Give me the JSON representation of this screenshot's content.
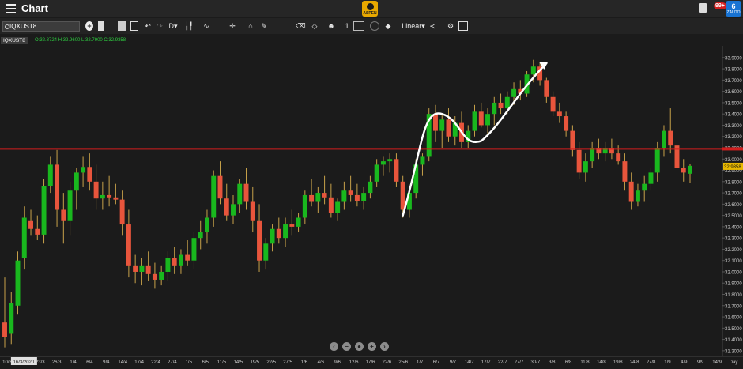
{
  "app": {
    "title": "Chart",
    "logo_text": "ASPEN",
    "notification_count": "99+",
    "zaloo_label": "ZALOO",
    "zaloo_number": "6"
  },
  "toolbar": {
    "symbol": "IQXUST8",
    "interval": "D",
    "line_width": "1",
    "scale": "Linear",
    "icons": [
      "plus-circle-icon",
      "new-page-icon",
      "open-folder-icon",
      "image-icon",
      "share-icon",
      "undo-icon",
      "redo-icon",
      "interval-dropdown",
      "candle-type-icon",
      "indicator-icon",
      "crosshair-icon",
      "alert-icon",
      "pen-icon",
      "eraser-icon",
      "fill-icon",
      "emoji-icon",
      "line-width-icon",
      "color-icon",
      "cancel-icon",
      "tag-icon",
      "scale-dropdown",
      "share-nodes-icon",
      "settings-icon",
      "keyboard-icon"
    ]
  },
  "chart_info": {
    "symbol_label": "IQXUST8",
    "ohlc_text": "O:32.8724  H:32.9600  L:32.7900  C:32.9358"
  },
  "colors": {
    "up": "#19b81e",
    "down": "#e8553c",
    "wick": "#c8a24a",
    "hline": "#d21e1e",
    "annotation": "#ffffff",
    "background": "#1b1b1b",
    "last_price_bg": "#e8b800"
  },
  "chart_data": {
    "type": "candlestick",
    "ylim": [
      31.25,
      33.99
    ],
    "y_ticks": [
      "33.9000",
      "33.8000",
      "33.7000",
      "33.6000",
      "33.5000",
      "33.4000",
      "33.3000",
      "33.2000",
      "33.1000",
      "33.0000",
      "32.9000",
      "32.8000",
      "32.7000",
      "32.6000",
      "32.5000",
      "32.4000",
      "32.3000",
      "32.2000",
      "32.1000",
      "32.0000",
      "31.9000",
      "31.8000",
      "31.7000",
      "31.6000",
      "31.5000",
      "31.4000",
      "31.3000"
    ],
    "x_tick_labels": [
      "10/3",
      "16/3/2020",
      "23/3",
      "26/3",
      "1/4",
      "6/4",
      "9/4",
      "14/4",
      "17/4",
      "22/4",
      "27/4",
      "1/5",
      "6/5",
      "11/5",
      "14/5",
      "19/5",
      "22/5",
      "27/5",
      "1/6",
      "4/6",
      "9/6",
      "12/6",
      "17/6",
      "22/6",
      "25/6",
      "1/7",
      "6/7",
      "9/7",
      "14/7",
      "17/7",
      "22/7",
      "27/7",
      "30/7",
      "3/8",
      "6/8",
      "11/8",
      "14/8",
      "19/8",
      "24/8",
      "27/8",
      "1/9",
      "4/9",
      "9/9",
      "14/9",
      "Day"
    ],
    "highlighted_x_label": "16/3/2020",
    "horizontal_line_value": 33.09,
    "last_price": "32.9358",
    "candles": [
      {
        "o": 31.55,
        "h": 31.95,
        "l": 31.33,
        "c": 31.42
      },
      {
        "o": 31.45,
        "h": 31.82,
        "l": 31.36,
        "c": 31.72
      },
      {
        "o": 31.7,
        "h": 32.18,
        "l": 31.62,
        "c": 32.1
      },
      {
        "o": 32.12,
        "h": 32.58,
        "l": 32.02,
        "c": 32.48
      },
      {
        "o": 32.45,
        "h": 32.55,
        "l": 32.32,
        "c": 32.38
      },
      {
        "o": 32.38,
        "h": 32.5,
        "l": 32.28,
        "c": 32.33
      },
      {
        "o": 32.33,
        "h": 32.82,
        "l": 32.25,
        "c": 32.76
      },
      {
        "o": 32.76,
        "h": 33.02,
        "l": 32.7,
        "c": 32.95
      },
      {
        "o": 32.95,
        "h": 33.08,
        "l": 32.4,
        "c": 32.55
      },
      {
        "o": 32.55,
        "h": 32.7,
        "l": 32.25,
        "c": 32.45
      },
      {
        "o": 32.45,
        "h": 32.8,
        "l": 32.32,
        "c": 32.72
      },
      {
        "o": 32.72,
        "h": 32.92,
        "l": 32.55,
        "c": 32.88
      },
      {
        "o": 32.88,
        "h": 33.02,
        "l": 32.75,
        "c": 32.93
      },
      {
        "o": 32.93,
        "h": 33.05,
        "l": 32.72,
        "c": 32.8
      },
      {
        "o": 32.8,
        "h": 32.95,
        "l": 32.55,
        "c": 32.65
      },
      {
        "o": 32.65,
        "h": 32.8,
        "l": 32.55,
        "c": 32.68
      },
      {
        "o": 32.68,
        "h": 32.85,
        "l": 32.58,
        "c": 32.66
      },
      {
        "o": 32.66,
        "h": 32.78,
        "l": 32.6,
        "c": 32.64
      },
      {
        "o": 32.64,
        "h": 32.72,
        "l": 32.32,
        "c": 32.42
      },
      {
        "o": 32.42,
        "h": 32.55,
        "l": 31.95,
        "c": 32.05
      },
      {
        "o": 32.05,
        "h": 32.15,
        "l": 31.9,
        "c": 32.0
      },
      {
        "o": 32.0,
        "h": 32.12,
        "l": 31.88,
        "c": 32.05
      },
      {
        "o": 32.05,
        "h": 32.18,
        "l": 31.92,
        "c": 31.98
      },
      {
        "o": 31.98,
        "h": 32.08,
        "l": 31.85,
        "c": 31.93
      },
      {
        "o": 31.93,
        "h": 32.05,
        "l": 31.88,
        "c": 32.0
      },
      {
        "o": 32.0,
        "h": 32.18,
        "l": 31.92,
        "c": 32.12
      },
      {
        "o": 32.12,
        "h": 32.22,
        "l": 31.98,
        "c": 32.05
      },
      {
        "o": 32.05,
        "h": 32.2,
        "l": 31.98,
        "c": 32.15
      },
      {
        "o": 32.15,
        "h": 32.28,
        "l": 32.05,
        "c": 32.1
      },
      {
        "o": 32.1,
        "h": 32.35,
        "l": 32.02,
        "c": 32.3
      },
      {
        "o": 32.3,
        "h": 32.45,
        "l": 32.2,
        "c": 32.35
      },
      {
        "o": 32.35,
        "h": 32.55,
        "l": 32.25,
        "c": 32.48
      },
      {
        "o": 32.48,
        "h": 32.9,
        "l": 32.4,
        "c": 32.85
      },
      {
        "o": 32.85,
        "h": 32.98,
        "l": 32.6,
        "c": 32.65
      },
      {
        "o": 32.65,
        "h": 32.78,
        "l": 32.45,
        "c": 32.5
      },
      {
        "o": 32.5,
        "h": 32.68,
        "l": 32.42,
        "c": 32.6
      },
      {
        "o": 32.6,
        "h": 32.82,
        "l": 32.52,
        "c": 32.78
      },
      {
        "o": 32.78,
        "h": 32.92,
        "l": 32.55,
        "c": 32.62
      },
      {
        "o": 32.62,
        "h": 32.75,
        "l": 32.35,
        "c": 32.45
      },
      {
        "o": 32.45,
        "h": 32.6,
        "l": 32.0,
        "c": 32.1
      },
      {
        "o": 32.1,
        "h": 32.3,
        "l": 32.02,
        "c": 32.25
      },
      {
        "o": 32.25,
        "h": 32.42,
        "l": 32.18,
        "c": 32.38
      },
      {
        "o": 32.38,
        "h": 32.48,
        "l": 32.25,
        "c": 32.3
      },
      {
        "o": 32.3,
        "h": 32.48,
        "l": 32.22,
        "c": 32.42
      },
      {
        "o": 32.42,
        "h": 32.55,
        "l": 32.32,
        "c": 32.4
      },
      {
        "o": 32.4,
        "h": 32.52,
        "l": 32.35,
        "c": 32.48
      },
      {
        "o": 32.48,
        "h": 32.72,
        "l": 32.42,
        "c": 32.68
      },
      {
        "o": 32.68,
        "h": 32.82,
        "l": 32.58,
        "c": 32.62
      },
      {
        "o": 32.62,
        "h": 32.75,
        "l": 32.52,
        "c": 32.7
      },
      {
        "o": 32.7,
        "h": 32.85,
        "l": 32.6,
        "c": 32.66
      },
      {
        "o": 32.66,
        "h": 32.78,
        "l": 32.48,
        "c": 32.52
      },
      {
        "o": 32.52,
        "h": 32.65,
        "l": 32.45,
        "c": 32.62
      },
      {
        "o": 32.62,
        "h": 32.8,
        "l": 32.55,
        "c": 32.72
      },
      {
        "o": 32.72,
        "h": 32.85,
        "l": 32.62,
        "c": 32.68
      },
      {
        "o": 32.68,
        "h": 32.78,
        "l": 32.58,
        "c": 32.63
      },
      {
        "o": 32.63,
        "h": 32.75,
        "l": 32.55,
        "c": 32.7
      },
      {
        "o": 32.7,
        "h": 32.85,
        "l": 32.65,
        "c": 32.8
      },
      {
        "o": 32.8,
        "h": 33.0,
        "l": 32.75,
        "c": 32.95
      },
      {
        "o": 32.95,
        "h": 33.02,
        "l": 32.85,
        "c": 32.98
      },
      {
        "o": 32.98,
        "h": 33.05,
        "l": 32.88,
        "c": 33.0
      },
      {
        "o": 33.0,
        "h": 33.05,
        "l": 32.75,
        "c": 32.8
      },
      {
        "o": 32.8,
        "h": 32.85,
        "l": 32.48,
        "c": 32.55
      },
      {
        "o": 32.55,
        "h": 32.75,
        "l": 32.48,
        "c": 32.7
      },
      {
        "o": 32.7,
        "h": 33.0,
        "l": 32.65,
        "c": 32.95
      },
      {
        "o": 32.95,
        "h": 33.05,
        "l": 32.85,
        "c": 33.02
      },
      {
        "o": 33.02,
        "h": 33.45,
        "l": 32.98,
        "c": 33.4
      },
      {
        "o": 33.4,
        "h": 33.48,
        "l": 33.15,
        "c": 33.25
      },
      {
        "o": 33.25,
        "h": 33.4,
        "l": 33.1,
        "c": 33.35
      },
      {
        "o": 33.35,
        "h": 33.45,
        "l": 33.15,
        "c": 33.2
      },
      {
        "o": 33.2,
        "h": 33.38,
        "l": 33.12,
        "c": 33.32
      },
      {
        "o": 33.32,
        "h": 33.42,
        "l": 33.1,
        "c": 33.15
      },
      {
        "o": 33.15,
        "h": 33.3,
        "l": 33.1,
        "c": 33.25
      },
      {
        "o": 33.25,
        "h": 33.48,
        "l": 33.2,
        "c": 33.42
      },
      {
        "o": 33.42,
        "h": 33.5,
        "l": 33.28,
        "c": 33.3
      },
      {
        "o": 33.3,
        "h": 33.45,
        "l": 33.22,
        "c": 33.4
      },
      {
        "o": 33.4,
        "h": 33.55,
        "l": 33.3,
        "c": 33.5
      },
      {
        "o": 33.5,
        "h": 33.58,
        "l": 33.4,
        "c": 33.45
      },
      {
        "o": 33.45,
        "h": 33.6,
        "l": 33.4,
        "c": 33.55
      },
      {
        "o": 33.55,
        "h": 33.68,
        "l": 33.48,
        "c": 33.62
      },
      {
        "o": 33.62,
        "h": 33.7,
        "l": 33.52,
        "c": 33.58
      },
      {
        "o": 33.58,
        "h": 33.78,
        "l": 33.55,
        "c": 33.75
      },
      {
        "o": 33.75,
        "h": 33.88,
        "l": 33.68,
        "c": 33.82
      },
      {
        "o": 33.82,
        "h": 33.85,
        "l": 33.65,
        "c": 33.7
      },
      {
        "o": 33.7,
        "h": 33.72,
        "l": 33.5,
        "c": 33.55
      },
      {
        "o": 33.55,
        "h": 33.6,
        "l": 33.38,
        "c": 33.42
      },
      {
        "o": 33.42,
        "h": 33.5,
        "l": 33.32,
        "c": 33.38
      },
      {
        "o": 33.38,
        "h": 33.42,
        "l": 33.2,
        "c": 33.25
      },
      {
        "o": 33.25,
        "h": 33.3,
        "l": 33.02,
        "c": 33.08
      },
      {
        "o": 33.08,
        "h": 33.15,
        "l": 32.82,
        "c": 32.88
      },
      {
        "o": 32.88,
        "h": 33.05,
        "l": 32.8,
        "c": 32.98
      },
      {
        "o": 32.98,
        "h": 33.15,
        "l": 32.92,
        "c": 33.1
      },
      {
        "o": 33.1,
        "h": 33.18,
        "l": 33.0,
        "c": 33.05
      },
      {
        "o": 33.05,
        "h": 33.15,
        "l": 32.98,
        "c": 33.1
      },
      {
        "o": 33.1,
        "h": 33.18,
        "l": 33.0,
        "c": 33.05
      },
      {
        "o": 33.05,
        "h": 33.12,
        "l": 32.95,
        "c": 32.98
      },
      {
        "o": 32.98,
        "h": 33.05,
        "l": 32.72,
        "c": 32.8
      },
      {
        "o": 32.8,
        "h": 32.88,
        "l": 32.55,
        "c": 32.62
      },
      {
        "o": 32.62,
        "h": 32.78,
        "l": 32.58,
        "c": 32.72
      },
      {
        "o": 32.72,
        "h": 32.85,
        "l": 32.62,
        "c": 32.78
      },
      {
        "o": 32.78,
        "h": 32.92,
        "l": 32.72,
        "c": 32.88
      },
      {
        "o": 32.88,
        "h": 33.15,
        "l": 32.8,
        "c": 33.1
      },
      {
        "o": 33.1,
        "h": 33.3,
        "l": 33.02,
        "c": 33.25
      },
      {
        "o": 33.25,
        "h": 33.45,
        "l": 33.05,
        "c": 33.12
      },
      {
        "o": 33.12,
        "h": 33.2,
        "l": 32.85,
        "c": 32.92
      },
      {
        "o": 32.92,
        "h": 33.0,
        "l": 32.8,
        "c": 32.88
      },
      {
        "o": 32.87,
        "h": 32.96,
        "l": 32.79,
        "c": 32.94
      }
    ]
  }
}
